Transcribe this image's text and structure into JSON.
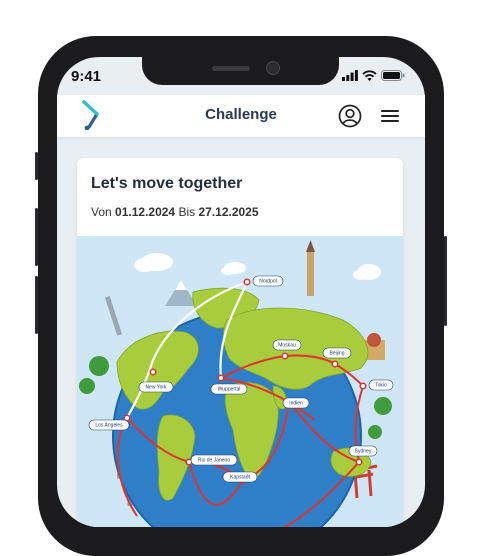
{
  "status_bar": {
    "time": "9:41"
  },
  "header": {
    "title": "Challenge"
  },
  "challenge": {
    "name": "Let's move together",
    "from_label": "Von",
    "start_date": "01.12.2024",
    "to_label": "Bis",
    "end_date": "27.12.2025"
  },
  "map": {
    "cities": [
      {
        "name": "Nordpol"
      },
      {
        "name": "Moskau"
      },
      {
        "name": "Beijing"
      },
      {
        "name": "New York"
      },
      {
        "name": "Wuppertal"
      },
      {
        "name": "Tokio"
      },
      {
        "name": "Los Angeles"
      },
      {
        "name": "Indien"
      },
      {
        "name": "Sydney"
      },
      {
        "name": "Rio de Janeiro"
      },
      {
        "name": "Kapstadt"
      }
    ],
    "colors": {
      "ocean": "#2f7fc8",
      "land": "#a8cc3c",
      "route_done": "#ffffff",
      "route_planned": "#e0342e"
    }
  }
}
